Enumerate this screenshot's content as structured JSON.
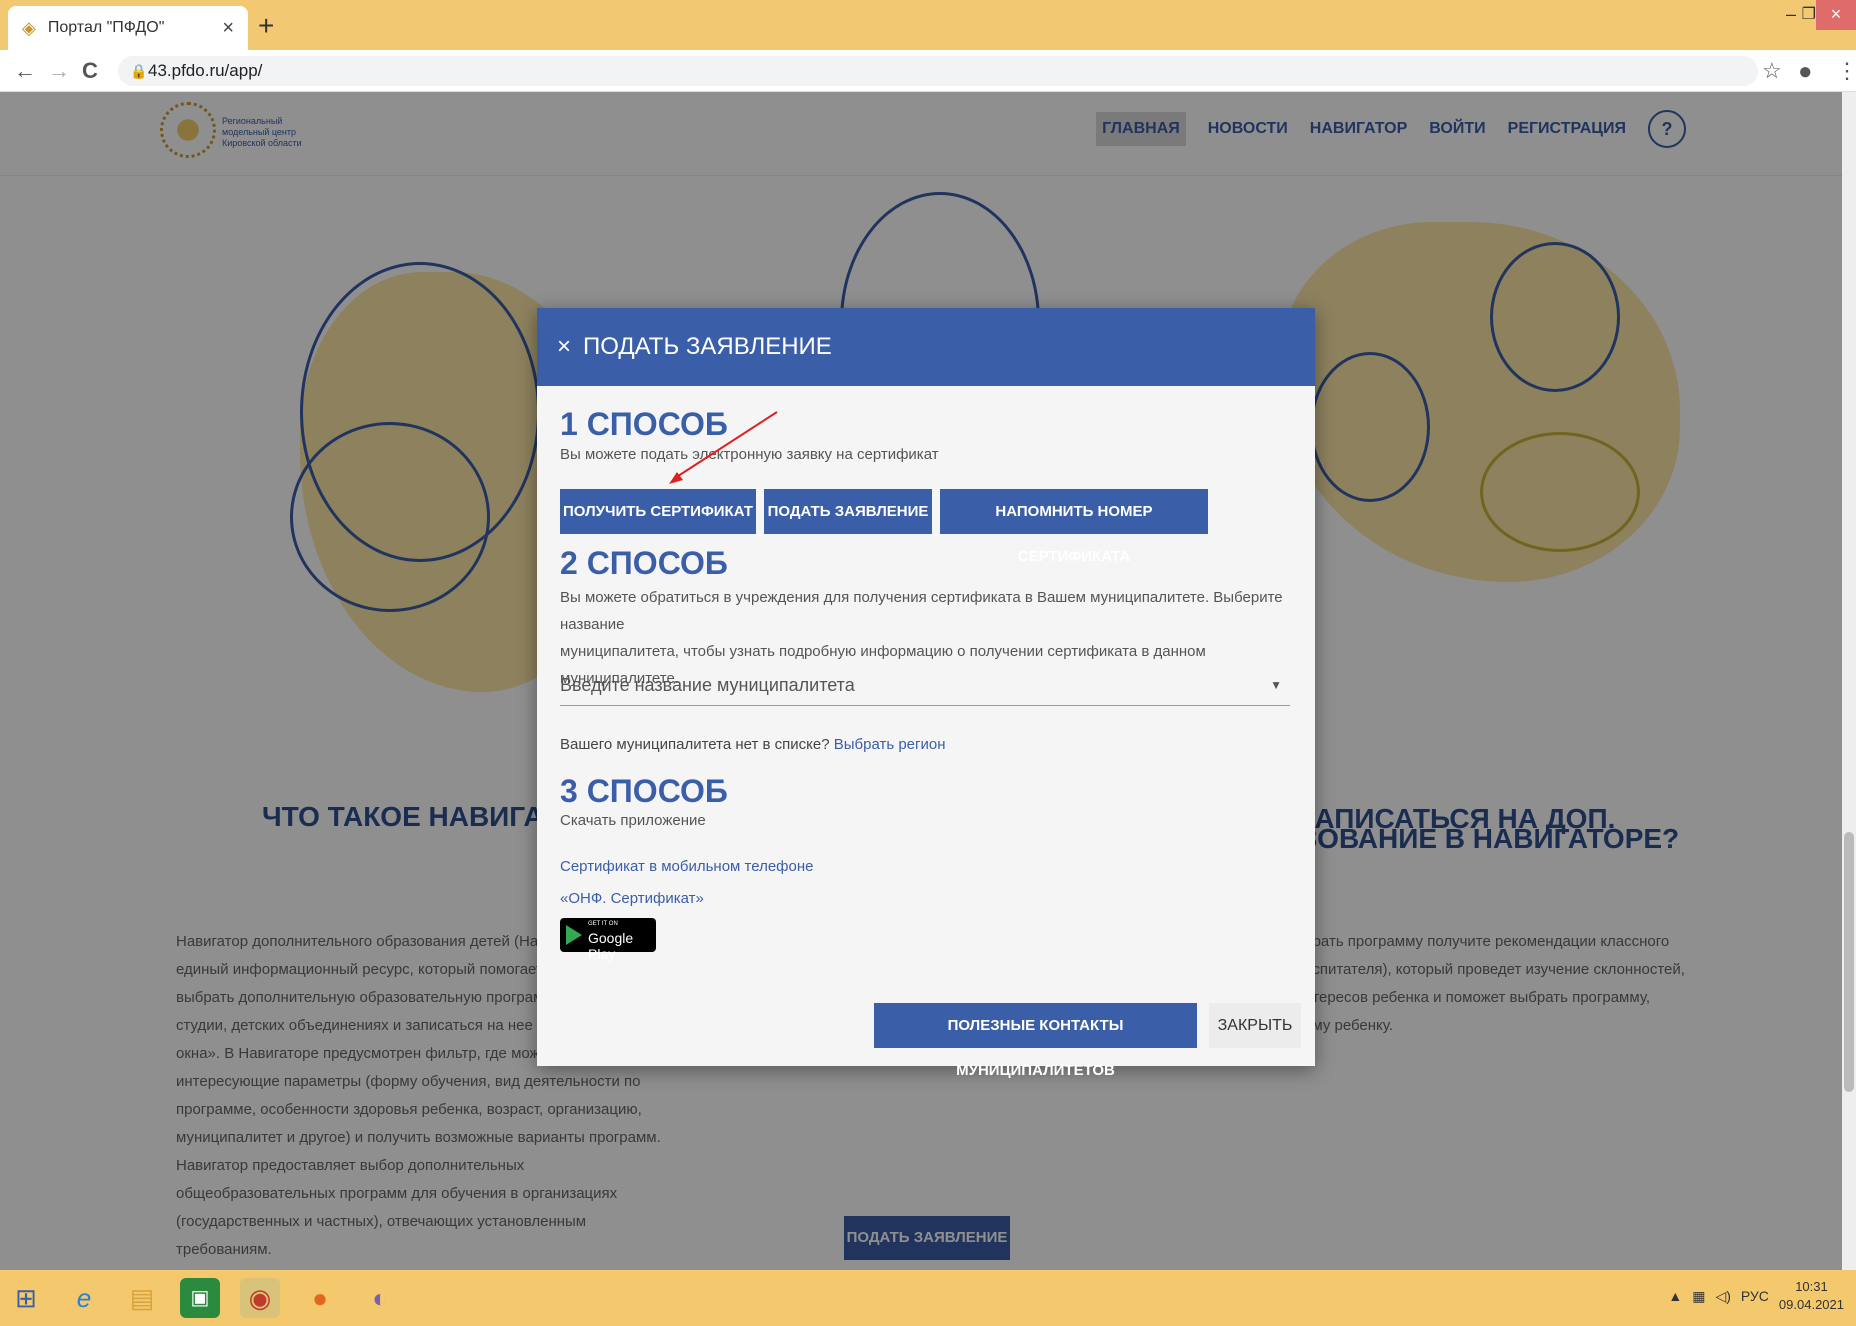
{
  "browser": {
    "tab_title": "Портал \"ПФДО\"",
    "tab_close": "×",
    "new_tab": "+",
    "url": "43.pfdo.ru/app/",
    "back": "←",
    "forward": "→",
    "reload": "C",
    "star": "☆",
    "menu": "⋮",
    "win_min": "–",
    "win_max": "❐",
    "win_close": "×"
  },
  "site": {
    "logo_text": "Региональный модельный центр Кировской области",
    "nav": [
      "ГЛАВНАЯ",
      "НОВОСТИ",
      "НАВИГАТОР",
      "ВОЙТИ",
      "РЕГИСТРАЦИЯ"
    ],
    "help": "?",
    "left_heading": "ЧТО ТАКОЕ НАВИГАТО",
    "right_heading_1": "К ЗАПИСАТЬСЯ НА ДОП.",
    "right_heading_2": "ЗОВАНИЕ В НАВИГАТОРЕ?",
    "left_paragraph": [
      "Навигатор дополнительного образования детей (Навиг",
      "единый информационный ресурс, который помогает р",
      "выбрать дополнительную образовательную программу",
      "студии, детских объединениях и записаться на нее по п",
      "окна».  В Навигаторе предусмотрен фильтр, где можно",
      "интересующие параметры (форму обучения, вид деятельности по",
      "программе, особенности здоровья ребенка, возраст, организацию,",
      "муниципалитет и другое) и получить возможные варианты программ.",
      "Навигатор предоставляет выбор дополнительных",
      "общеобразовательных программ для обучения в организациях",
      "(государственных и частных), отвечающих установленным",
      "требованиям."
    ],
    "right_paragraph": [
      "брать программу получите рекомендации классного",
      "оспитателя), который проведет изучение склонностей,",
      "нтересов ребенка и поможет выбрать программу,",
      "ему ребенку."
    ],
    "bottom_apply": "ПОДАТЬ ЗАЯВЛЕНИЕ"
  },
  "modal": {
    "close_icon": "×",
    "title": "ПОДАТЬ ЗАЯВЛЕНИЕ",
    "way1": {
      "heading": "1 СПОСОБ",
      "subtitle": "Вы можете подать электронную заявку на сертификат",
      "buttons": [
        "ПОЛУЧИТЬ СЕРТИФИКАТ",
        "ПОДАТЬ ЗАЯВЛЕНИЕ",
        "НАПОМНИТЬ НОМЕР СЕРТИФИКАТА"
      ]
    },
    "way2": {
      "heading": "2 СПОСОБ",
      "line1": "Вы можете обратиться в учреждения для получения сертификата в Вашем муниципалитете. Выберите название",
      "line2": "муниципалитета, чтобы узнать подробную информацию о получении сертификата в данном муниципалитете.",
      "select_placeholder": "Введите название муниципалитета",
      "missing_text": "Вашего муниципалитета нет в списке? ",
      "missing_link": "Выбрать регион"
    },
    "way3": {
      "heading": "3 СПОСОБ",
      "subtitle": "Скачать приложение",
      "link1": "Сертификат в мобильном телефоне",
      "link2": "«ОНФ. Сертификат»",
      "gplay_small": "GET IT ON",
      "gplay_big": "Google Play"
    },
    "contacts_button": "ПОЛЕЗНЫЕ КОНТАКТЫ МУНИЦИПАЛИТЕТОВ",
    "close_button": "ЗАКРЫТЬ"
  },
  "taskbar": {
    "lang": "РУС",
    "time": "10:31",
    "date": "09.04.2021"
  },
  "colors": {
    "brand": "#3b5ea8",
    "chrome": "#f2c972",
    "arrow": "#e02020"
  }
}
